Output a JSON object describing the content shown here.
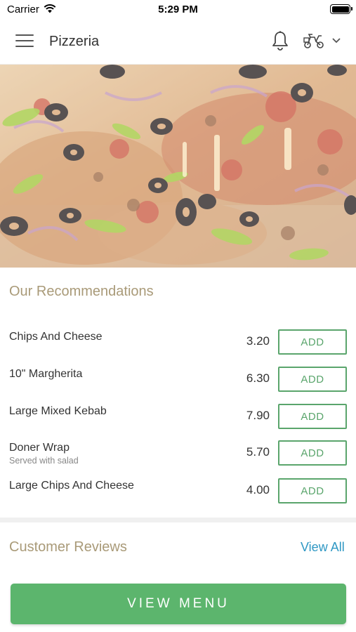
{
  "status_bar": {
    "carrier": "Carrier",
    "time": "5:29 PM"
  },
  "app_bar": {
    "title": "Pizzeria"
  },
  "recommendations": {
    "title": "Our Recommendations",
    "items": [
      {
        "name": "Chips And Cheese",
        "subtitle": "",
        "price": "3.20",
        "action": "ADD"
      },
      {
        "name": "10\" Margherita",
        "subtitle": "",
        "price": "6.30",
        "action": "ADD"
      },
      {
        "name": "Large Mixed Kebab",
        "subtitle": "",
        "price": "7.90",
        "action": "ADD"
      },
      {
        "name": "Doner Wrap",
        "subtitle": "Served with salad",
        "price": "5.70",
        "action": "ADD"
      },
      {
        "name": "Large Chips And Cheese",
        "subtitle": "",
        "price": "4.00",
        "action": "ADD"
      }
    ]
  },
  "reviews": {
    "title": "Customer Reviews",
    "view_all": "View All"
  },
  "footer": {
    "view_menu": "VIEW MENU"
  },
  "colors": {
    "accent_green": "#5cb56d",
    "section_title": "#a99a78",
    "link_blue": "#2f98c4"
  }
}
